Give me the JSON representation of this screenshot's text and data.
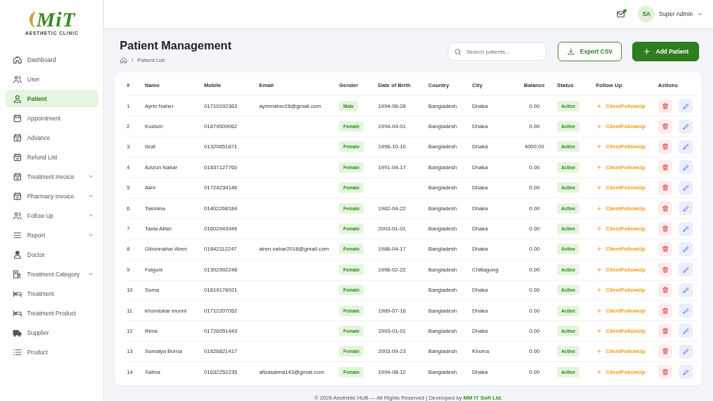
{
  "logo": {
    "mark": "MiT",
    "subtitle": "AESTHETIC CLINIC"
  },
  "sidebar": {
    "items": [
      {
        "label": "Dashboard",
        "selected": false,
        "expandable": false
      },
      {
        "label": "User",
        "selected": false,
        "expandable": false
      },
      {
        "label": "Patient",
        "selected": true,
        "expandable": false
      },
      {
        "label": "Appointment",
        "selected": false,
        "expandable": false
      },
      {
        "label": "Advance",
        "selected": false,
        "expandable": false
      },
      {
        "label": "Refund List",
        "selected": false,
        "expandable": false
      },
      {
        "label": "Treatment Invoice",
        "selected": false,
        "expandable": true
      },
      {
        "label": "Pharmacy Invoice",
        "selected": false,
        "expandable": true
      },
      {
        "label": "Follow Up",
        "selected": false,
        "expandable": true
      },
      {
        "label": "Report",
        "selected": false,
        "expandable": true
      },
      {
        "label": "Doctor",
        "selected": false,
        "expandable": false
      },
      {
        "label": "Treatment Category",
        "selected": false,
        "expandable": true
      },
      {
        "label": "Treatment",
        "selected": false,
        "expandable": false
      },
      {
        "label": "Treatment Product",
        "selected": false,
        "expandable": false
      },
      {
        "label": "Supplier",
        "selected": false,
        "expandable": false
      },
      {
        "label": "Product",
        "selected": false,
        "expandable": false
      }
    ]
  },
  "topbar": {
    "notification": true,
    "avatar": "SA",
    "user": "Super Admin"
  },
  "page": {
    "title": "Patient Management",
    "breadcrumb": {
      "separator": "/",
      "current": "Patient List"
    }
  },
  "search": {
    "placeholder": "Search patients..."
  },
  "actions": [
    {
      "label": "Export CSV",
      "kind": "outline"
    },
    {
      "label": "Add Patient",
      "kind": "primary"
    }
  ],
  "table": {
    "columns": [
      "#",
      "Name",
      "Mobile",
      "Email",
      "Gender",
      "Date of Birth",
      "Country",
      "City",
      "Balance",
      "Status",
      "Follow Up",
      "Actions"
    ],
    "rows": [
      {
        "no": "1",
        "name": "Ayrin Naher",
        "mobile": "01710292363",
        "email": "ayrinnaher28@gmail.com",
        "gender": "Male",
        "dob": "1994-06-28",
        "country": "Bangladesh",
        "city": "Dhaka",
        "balance": "0.00",
        "status": "Active",
        "follow_up": "ClientFollowUp"
      },
      {
        "no": "2",
        "name": "Kuslum",
        "mobile": "01874509062",
        "gender": "Female",
        "dob": "1994-04-01",
        "country": "Bangladesh",
        "city": "Dhaka",
        "balance": "0.00",
        "status": "Active",
        "follow_up": "ClientFollowUp"
      },
      {
        "no": "3",
        "name": "Israt",
        "mobile": "01320651871",
        "gender": "Female",
        "dob": "1996-10-10",
        "country": "Bangladesh",
        "city": "Dhaka",
        "balance": "4000.00",
        "status": "Active",
        "follow_up": "ClientFollowUp"
      },
      {
        "no": "4",
        "name": "Azizun Nahar",
        "mobile": "01837127760",
        "gender": "Female",
        "dob": "1991-04-17",
        "country": "Bangladesh",
        "city": "Dhaka",
        "balance": "0.00",
        "status": "Active",
        "follow_up": "ClientFollowUp"
      },
      {
        "no": "5",
        "name": "Akhi",
        "mobile": "01724234146",
        "gender": "Female",
        "country": "Bangladesh",
        "city": "Dhaka",
        "balance": "0.00",
        "status": "Active",
        "follow_up": "ClientFollowUp"
      },
      {
        "no": "6",
        "name": "Tasmina",
        "mobile": "01402268184",
        "gender": "Female",
        "dob": "1982-04-22",
        "country": "Bangladesh",
        "city": "Dhaka",
        "balance": "0.00",
        "status": "Active",
        "follow_up": "ClientFollowUp"
      },
      {
        "no": "7",
        "name": "Tania Akter",
        "mobile": "01602943949",
        "gender": "Female",
        "dob": "2003-01-01",
        "country": "Bangladesh",
        "city": "Dhaka",
        "balance": "0.00",
        "status": "Active",
        "follow_up": "ClientFollowUp"
      },
      {
        "no": "8",
        "name": "Gibonnahar Airen",
        "mobile": "01842112247",
        "email": "airen.nahar2018@gmail.com",
        "gender": "Female",
        "dob": "1986-04-17",
        "country": "Bangladesh",
        "city": "Dhaka",
        "balance": "0.00",
        "status": "Active",
        "follow_up": "ClientFollowUp"
      },
      {
        "no": "9",
        "name": "Falguni",
        "mobile": "01302992248",
        "gender": "Female",
        "dob": "1996-02-22",
        "country": "Bangladesh",
        "city": "Chittagong",
        "balance": "0.00",
        "status": "Active",
        "follow_up": "ClientFollowUp"
      },
      {
        "no": "10",
        "name": "Suma",
        "mobile": "01819178921",
        "gender": "Female",
        "country": "Bangladesh",
        "city": "Dhaka",
        "balance": "0.00",
        "status": "Active",
        "follow_up": "ClientFollowUp"
      },
      {
        "no": "11",
        "name": "khondokar munni",
        "mobile": "01712207052",
        "gender": "Female",
        "dob": "1989-07-16",
        "country": "Bangladesh",
        "city": "Dhaka",
        "balance": "0.00",
        "status": "Active",
        "follow_up": "ClientFollowUp"
      },
      {
        "no": "12",
        "name": "Rima",
        "mobile": "01726051443",
        "gender": "Female",
        "dob": "1993-01-01",
        "country": "Bangladesh",
        "city": "Dhaka",
        "balance": "0.00",
        "status": "Active",
        "follow_up": "ClientFollowUp"
      },
      {
        "no": "13",
        "name": "Sumaiya Borna",
        "mobile": "01826821417",
        "gender": "Female",
        "dob": "2003-09-23",
        "country": "Bangladesh",
        "city": "Khulna",
        "balance": "0.00",
        "status": "Active",
        "follow_up": "ClientFollowUp"
      },
      {
        "no": "14",
        "name": "Salma",
        "mobile": "01632252235",
        "email": "afizasalma143@gmail.com",
        "gender": "Female",
        "dob": "1994-08-12",
        "country": "Bangladesh",
        "city": "Dhaka",
        "balance": "0.00",
        "status": "Active",
        "follow_up": "ClientFollowUp"
      }
    ]
  },
  "footer": {
    "text": "© 2026 Aesthetic HUB — All Rights Reserved  |  Developed by",
    "link": "MM IT Soft Ltd."
  }
}
